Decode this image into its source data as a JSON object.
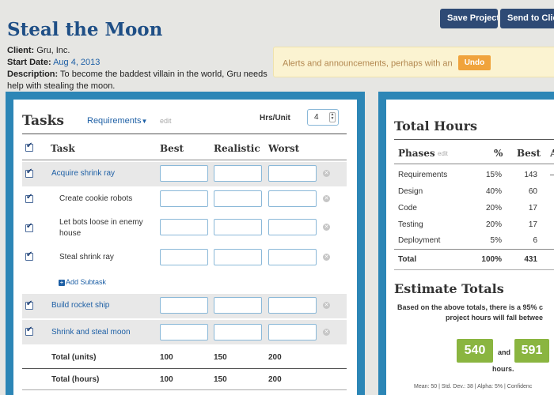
{
  "project": {
    "title": "Steal the Moon",
    "client_label": "Client:",
    "client_value": "Gru, Inc.",
    "start_label": "Start Date:",
    "start_value": "Aug 4, 2013",
    "desc_label": "Description:",
    "desc_value": "To become the baddest villain in the world, Gru needs help with stealing the moon."
  },
  "toolbar": {
    "save_label": "Save Project",
    "send_label": "Send to Client"
  },
  "alert": {
    "text": "Alerts and announcements, perhaps with an",
    "undo_label": "Undo"
  },
  "tasks": {
    "title": "Tasks",
    "dropdown_label": "Requirements",
    "edit_label": "edit",
    "hrs_label": "Hrs/Unit",
    "hrs_value": "4",
    "headers": {
      "task": "Task",
      "best": "Best",
      "realistic": "Realistic",
      "worst": "Worst"
    },
    "rows": [
      {
        "label": "Acquire shrink ray"
      },
      {
        "label": "Create cookie robots"
      },
      {
        "label": "Let bots loose in enemy house"
      },
      {
        "label": "Steal shrink ray"
      },
      {
        "label": "Build rocket ship"
      },
      {
        "label": "Shrink and steal moon"
      }
    ],
    "add_subtask_label": "Add Subtask",
    "totals_units": {
      "label": "Total (units)",
      "best": "100",
      "realistic": "150",
      "worst": "200"
    },
    "totals_hours": {
      "label": "Total (hours)",
      "best": "100",
      "realistic": "150",
      "worst": "200"
    }
  },
  "total_hours": {
    "title": "Total Hours",
    "phases_label": "Phases",
    "edit_label": "edit",
    "pct_label": "%",
    "best_label": "Best",
    "next_col_label": "A",
    "phases": [
      {
        "name": "Requirements",
        "pct": "15%",
        "best": "143"
      },
      {
        "name": "Design",
        "pct": "40%",
        "best": "60"
      },
      {
        "name": "Code",
        "pct": "20%",
        "best": "17"
      },
      {
        "name": "Testing",
        "pct": "20%",
        "best": "17"
      },
      {
        "name": "Deployment",
        "pct": "5%",
        "best": "6"
      }
    ],
    "total": {
      "name": "Total",
      "pct": "100%",
      "best": "431"
    }
  },
  "estimate": {
    "title": "Estimate Totals",
    "text_line1": "Based on the above totals, there is a 95% c",
    "text_line2": "project hours will fall betwee",
    "low": "540",
    "and_label": "and",
    "high": "591",
    "hours_label": "hours.",
    "stats": "Mean: 50 | Std. Dev.: 38 | Alpha: 5% | Confidenc"
  },
  "colors": {
    "title_blue": "#1f4f86",
    "frame_blue": "#2c86b6",
    "button_navy": "#2e4a75",
    "undo_orange": "#f0a33c",
    "badge_green": "#8ab540"
  }
}
